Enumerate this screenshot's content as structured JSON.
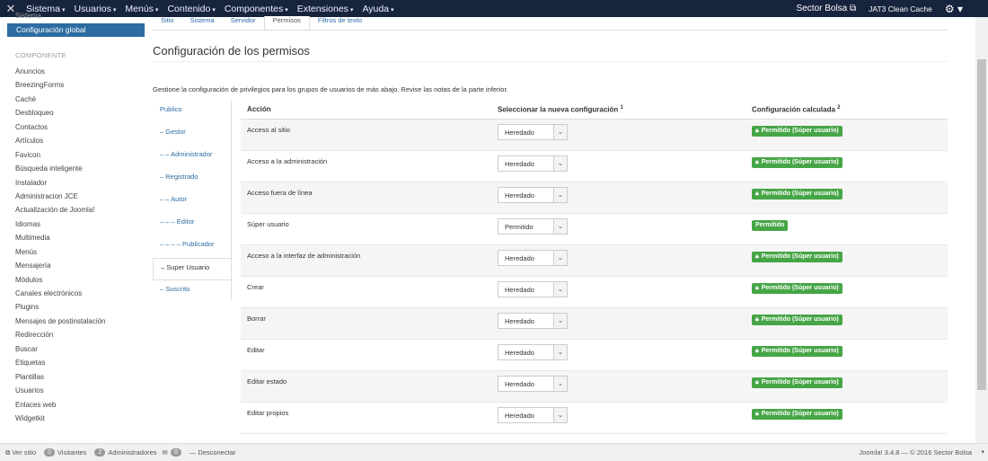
{
  "topbar": {
    "brand_icon": "joomla-icon",
    "menu": [
      {
        "label": "Sistema"
      },
      {
        "label": "Usuarios"
      },
      {
        "label": "Menús"
      },
      {
        "label": "Contenido"
      },
      {
        "label": "Componentes"
      },
      {
        "label": "Extensiones"
      },
      {
        "label": "Ayuda"
      }
    ],
    "site_label": "Sector Bolsa",
    "cache_label": "JAT3 Clean Cache"
  },
  "sidebar": {
    "hidden_top": "Sistema",
    "active_label": "Configuración global",
    "section_label": "COMPONENTE",
    "items": [
      "Anuncios",
      "BreezingForms",
      "Caché",
      "Desbloqueo",
      "Contactos",
      "Artículos",
      "Favicon",
      "Búsqueda inteligente",
      "Instalador",
      "Administracion JCE",
      "Actualización de Joomla!",
      "Idiomas",
      "Multimedia",
      "Menús",
      "Mensajería",
      "Módulos",
      "Canales electrónicos",
      "Plugins",
      "Mensajes de postinstalación",
      "Redirección",
      "Buscar",
      "Etiquetas",
      "Plantillas",
      "Usuarios",
      "Enlaces web",
      "Widgetkit"
    ]
  },
  "tabs": [
    "Sitio",
    "Sistema",
    "Servidor",
    "Permisos",
    "Filtros de texto"
  ],
  "page": {
    "title": "Configuración de los permisos",
    "description": "Gestione la configuración de privilegios para los grupos de usuarios de más abajo. Revise las notas de la parte inferior."
  },
  "groups": [
    "Publico",
    "– Gestor",
    "– – Administrador",
    "– Registrado",
    "– – Autor",
    "– – – Editor",
    "– – – – Publicador",
    "– Super Usuario",
    "– Suscrito"
  ],
  "table": {
    "headers": {
      "accion": "Acción",
      "seleccionar": "Seleccionar la nueva configuración",
      "seleccionar_sup": "1",
      "calculada": "Configuración calculada",
      "calculada_sup": "2"
    },
    "rows": [
      {
        "accion": "Acceso al sitio",
        "select": "Heredado",
        "badge": "Permitido (Súper usuario)"
      },
      {
        "accion": "Acceso a la administración",
        "select": "Heredado",
        "badge": "Permitido (Súper usuario)"
      },
      {
        "accion": "Acceso fuera de línea",
        "select": "Heredado",
        "badge": "Permitido (Súper usuario)"
      },
      {
        "accion": "Súper usuario",
        "select": "Permitido",
        "badge": "Permitido"
      },
      {
        "accion": "Acceso a la interfaz de administración",
        "select": "Heredado",
        "badge": "Permitido (Súper usuario)"
      },
      {
        "accion": "Crear",
        "select": "Heredado",
        "badge": "Permitido (Súper usuario)"
      },
      {
        "accion": "Borrar",
        "select": "Heredado",
        "badge": "Permitido (Súper usuario)"
      },
      {
        "accion": "Editar",
        "select": "Heredado",
        "badge": "Permitido (Súper usuario)"
      },
      {
        "accion": "Editar estado",
        "select": "Heredado",
        "badge": "Permitido (Súper usuario)"
      },
      {
        "accion": "Editar propios",
        "select": "Heredado",
        "badge": "Permitido (Súper usuario)"
      }
    ]
  },
  "status": {
    "ver_sitio": "Ver sitio",
    "visitantes_count": "0",
    "visitantes": "Visitantes",
    "admins_count": "2",
    "admins": "Administradores",
    "messages_count": "0",
    "desconectar": "Desconectar",
    "copyright": "Joomla! 3.4.8 — © 2016 Sector Bolsa"
  }
}
